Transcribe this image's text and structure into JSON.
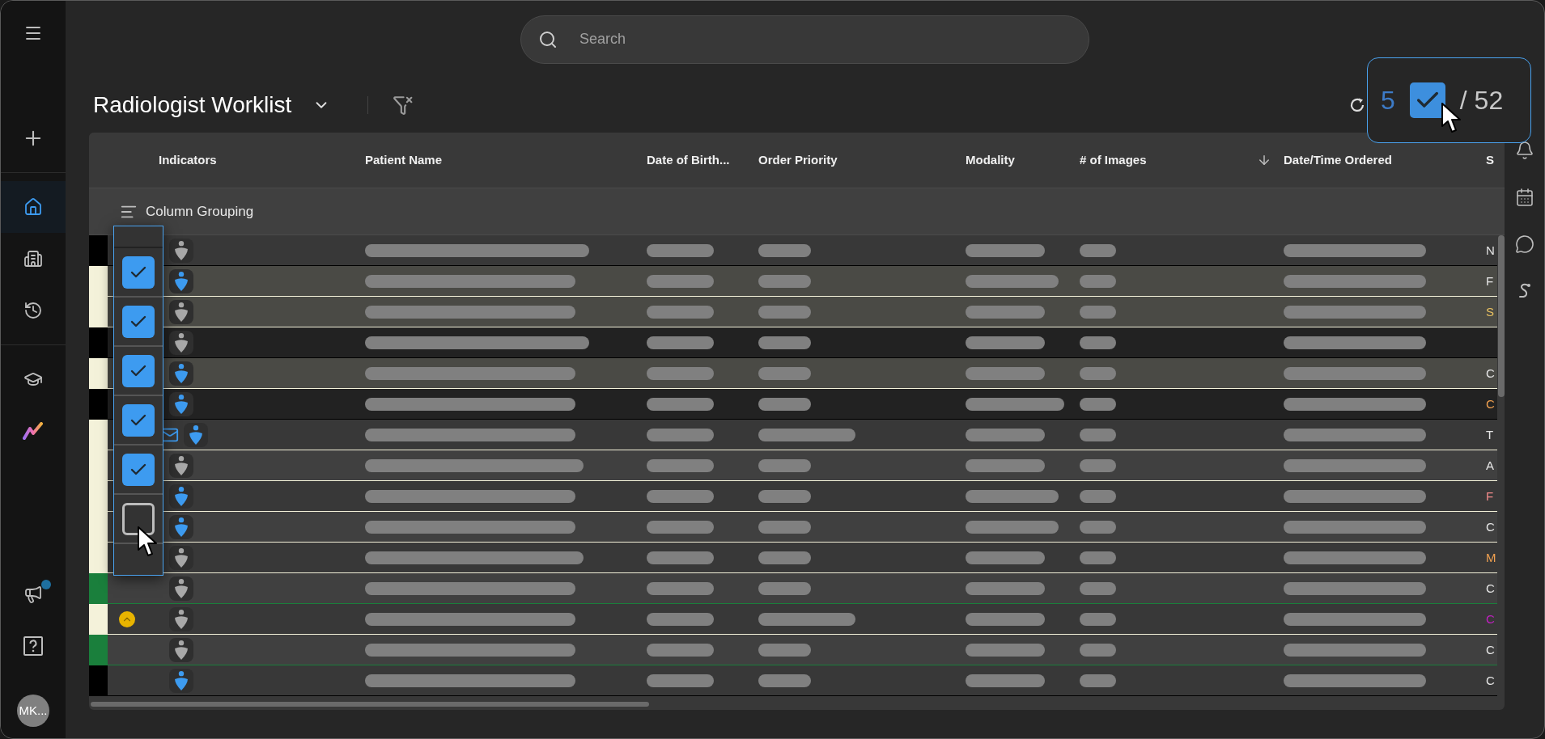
{
  "sidebar": {
    "top": [
      {
        "kind": "menu",
        "selected": false,
        "has_notification": false
      }
    ],
    "groups": [
      [
        {
          "kind": "plus",
          "selected": false,
          "has_notification": false
        }
      ],
      [
        {
          "kind": "home",
          "selected": true,
          "has_notification": false
        },
        {
          "kind": "building",
          "selected": false,
          "has_notification": false
        },
        {
          "kind": "history",
          "selected": false,
          "has_notification": false
        }
      ],
      [
        {
          "kind": "cap",
          "selected": false,
          "has_notification": false
        },
        {
          "kind": "logo",
          "selected": false,
          "has_notification": false
        }
      ]
    ],
    "bottom": [
      {
        "kind": "megaphone",
        "selected": false,
        "has_notification": true
      },
      {
        "kind": "help",
        "selected": false,
        "has_notification": false
      }
    ],
    "avatar": {
      "initials": "MK..."
    }
  },
  "search": {
    "placeholder": "Search"
  },
  "worklist": {
    "title": "Radiologist Worklist"
  },
  "selection": {
    "count": "5",
    "checked": true,
    "total": "/ 52"
  },
  "right_rail": [
    {
      "kind": "bell"
    },
    {
      "kind": "calendar"
    },
    {
      "kind": "chat"
    },
    {
      "kind": "s-curve"
    }
  ],
  "table": {
    "columns": [
      {
        "label": "Indicators",
        "sorted": false
      },
      {
        "label": "Patient Name",
        "sorted": false
      },
      {
        "label": "Date of Birth...",
        "sorted": false
      },
      {
        "label": "Order Priority",
        "sorted": false
      },
      {
        "label": "Modality",
        "sorted": false
      },
      {
        "label": "# of Images",
        "sorted": false
      },
      {
        "label": "Date/Time Ordered",
        "sorted": true
      },
      {
        "label": "S",
        "sorted": false
      }
    ],
    "grouping": {
      "label": "Column Grouping"
    },
    "row_checks": [
      {
        "checked": true
      },
      {
        "checked": true
      },
      {
        "checked": true
      },
      {
        "checked": true
      },
      {
        "checked": true
      },
      {
        "checked": false
      }
    ],
    "rows": [
      {
        "kind": "plain",
        "color": "#000000",
        "indicator": {
          "color": "#a8a8a8"
        },
        "mail": false,
        "status": {
          "text": "N",
          "color": "#e5e5e5"
        }
      },
      {
        "kind": "highlighted",
        "color": "#f4f2da",
        "indicator": {
          "color": "#3d9bf0"
        },
        "mail": false,
        "status": {
          "text": "F",
          "color": "#e5e5e5"
        }
      },
      {
        "kind": "highlighted",
        "color": "#f4f2da",
        "indicator": {
          "color": "#a8a8a8"
        },
        "mail": false,
        "status": {
          "text": "S",
          "color": "#e8c060"
        }
      },
      {
        "kind": "muted",
        "color": "#000000",
        "indicator": {
          "color": "#a8a8a8"
        },
        "mail": false
      },
      {
        "kind": "highlighted",
        "color": "#f4f2da",
        "indicator": {
          "color": "#3d9bf0"
        },
        "mail": false,
        "status": {
          "text": "C",
          "color": "#e5e5e5"
        }
      },
      {
        "kind": "muted",
        "color": "#000000",
        "indicator": {
          "color": "#3d9bf0"
        },
        "mail": false,
        "status": {
          "text": "C",
          "color": "#f0a050"
        }
      },
      {
        "kind": "plain",
        "color": "#f4f2da",
        "indicator": {
          "color": "#3d9bf0"
        },
        "mail": true,
        "status": {
          "text": "T",
          "color": "#e5e5e5"
        }
      },
      {
        "kind": "plain",
        "color": "#f4f2da",
        "indicator": {
          "color": "#a8a8a8"
        },
        "mail": false,
        "status": {
          "text": "A",
          "color": "#e5e5e5"
        }
      },
      {
        "kind": "plain",
        "color": "#f4f2da",
        "indicator": {
          "color": "#3d9bf0"
        },
        "mail": false,
        "status": {
          "text": "F",
          "color": "#f08a8a"
        }
      },
      {
        "kind": "plain",
        "color": "#f4f2da",
        "indicator": {
          "color": "#3d9bf0"
        },
        "mail": false,
        "status": {
          "text": "C",
          "color": "#e5e5e5"
        }
      },
      {
        "kind": "plain",
        "color": "#f4f2da",
        "indicator": {
          "color": "#a8a8a8"
        },
        "mail": false,
        "status": {
          "text": "M",
          "color": "#f0a050"
        }
      },
      {
        "kind": "plain",
        "color": "#1a7f3c",
        "indicator": {
          "color": "#a8a8a8"
        },
        "mail": false,
        "status": {
          "text": "C",
          "color": "#e5e5e5"
        }
      },
      {
        "kind": "plain",
        "color": "#f4f2da",
        "priority": {
          "color": "#e8b400"
        },
        "indicator": {
          "color": "#a8a8a8"
        },
        "mail": false,
        "status": {
          "text": "C",
          "color": "#c020c0"
        }
      },
      {
        "kind": "plain",
        "color": "#1a7f3c",
        "indicator": {
          "color": "#a8a8a8"
        },
        "mail": false,
        "status": {
          "text": "C",
          "color": "#e5e5e5"
        }
      },
      {
        "kind": "plain",
        "color": "#000000",
        "indicator": {
          "color": "#3d9bf0"
        },
        "mail": false,
        "status": {
          "text": "C",
          "color": "#e5e5e5"
        }
      }
    ]
  }
}
